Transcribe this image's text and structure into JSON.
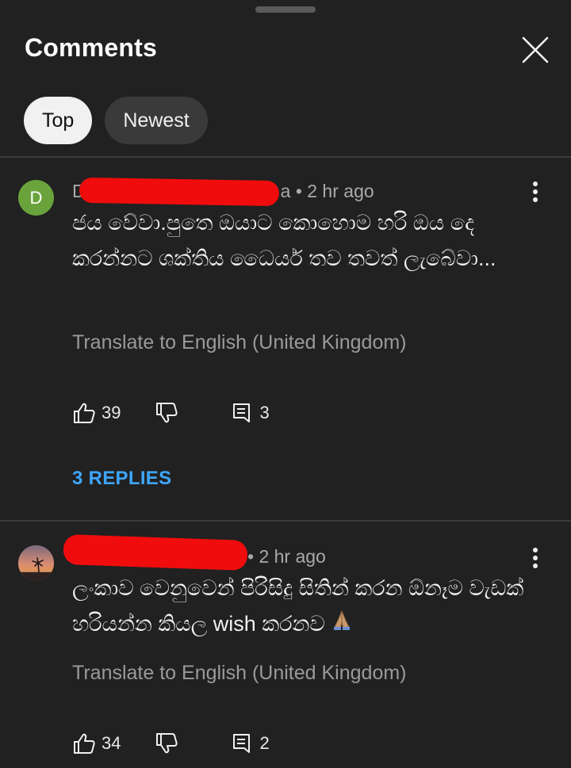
{
  "header": {
    "title": "Comments"
  },
  "sort_chips": [
    {
      "label": "Top",
      "selected": true
    },
    {
      "label": "Newest",
      "selected": false
    }
  ],
  "comments": [
    {
      "avatar_letter": "D",
      "avatar_color": "#6aa33c",
      "author_visible": "D",
      "author_tail": "a",
      "time": "• 2 hr ago",
      "text": "ජය වේවා.පුතෙ ඔයාට කොහොම හරි ඔය දෙ කරන්නට ශක්තිය ධෛර්ය තව තවත් ලැබේවා...",
      "translate_label": "Translate to English (United Kingdom)",
      "likes": "39",
      "reply_count": "3",
      "replies_label": "3 REPLIES"
    },
    {
      "avatar_letter": "",
      "time": "• 2 hr ago",
      "text": "ලංකාව වෙනුවෙන් පිරිසිදු සිතින් කරන ඕනෑම වැඩක් හරියන්න කියල wish කරනව",
      "emoji": "folded-hands-icon",
      "translate_label": "Translate to English (United Kingdom)",
      "likes": "34",
      "reply_count": "2"
    }
  ],
  "colors": {
    "background": "#212121",
    "link_blue": "#3ea6ff",
    "redaction": "#f00c0c"
  }
}
